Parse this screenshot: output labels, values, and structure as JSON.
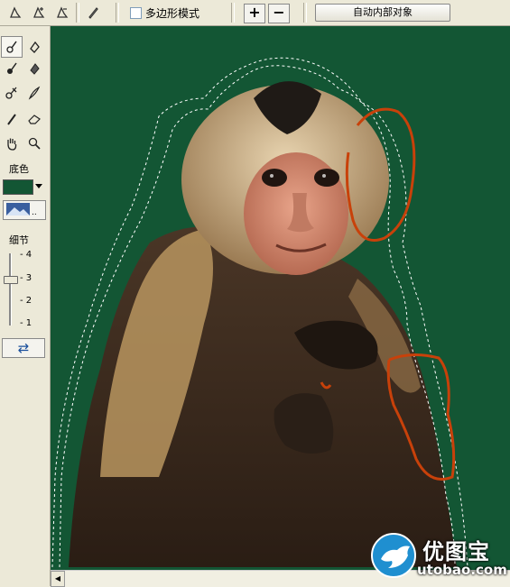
{
  "toolbar": {
    "tools": [
      "lasso-pen-icon",
      "lasso-pen-add-icon",
      "lasso-pen-subtract-icon",
      "brush-pen-icon"
    ],
    "polygon_mode_label": "多边形模式",
    "plus_label": "+",
    "minus_label": "−",
    "auto_button_label": "自动内部对象"
  },
  "left_panel": {
    "tools": [
      "edge-highlighter-icon",
      "fill-bucket-icon",
      "edge-highlighter-add-icon",
      "fill-bucket-alt-icon",
      "edge-cleanup-icon",
      "edge-touchup-icon",
      "brush-icon",
      "eraser-icon",
      "hand-icon",
      "magnifier-icon"
    ],
    "background_color_label": "底色",
    "background_color": "#135634",
    "detail_label": "细节",
    "detail_ticks": [
      "4",
      "3",
      "2",
      "1"
    ],
    "detail_value": 3,
    "cycle_icon": "refresh-icon"
  },
  "canvas": {
    "background": "#135634",
    "selection_outline_color": "#ffffff",
    "marker_color": "#c8410a"
  },
  "watermark": {
    "brand_name": "优图宝",
    "brand_url": "utobao.com"
  }
}
